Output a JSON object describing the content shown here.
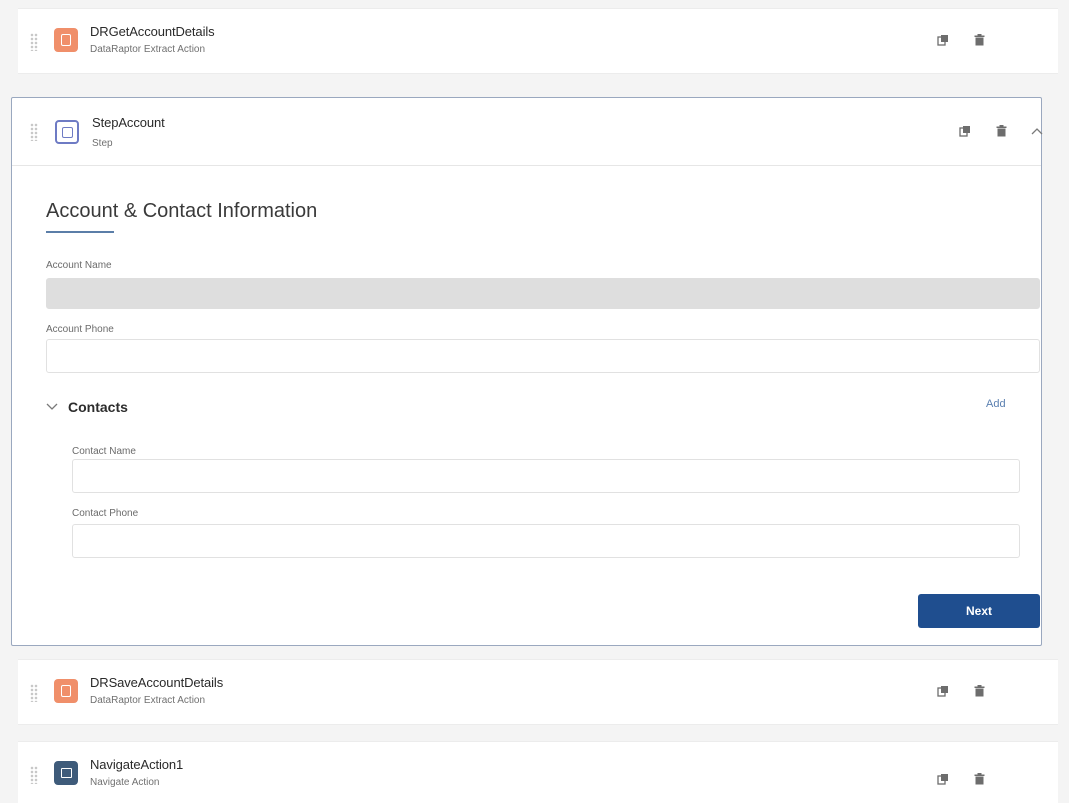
{
  "steps": [
    {
      "title": "DRGetAccountDetails",
      "subtitle": "DataRaptor Extract Action"
    },
    {
      "title": "StepAccount",
      "subtitle": "Step"
    },
    {
      "title": "DRSaveAccountDetails",
      "subtitle": "DataRaptor Extract Action"
    },
    {
      "title": "NavigateAction1",
      "subtitle": "Navigate Action"
    }
  ],
  "form": {
    "heading": "Account & Contact Information",
    "account_name_label": "Account Name",
    "account_name_value": "",
    "account_phone_label": "Account Phone",
    "account_phone_value": "",
    "contacts_label": "Contacts",
    "add_label": "Add",
    "contact_name_label": "Contact Name",
    "contact_name_value": "",
    "contact_phone_label": "Contact Phone",
    "contact_phone_value": "",
    "next_label": "Next"
  },
  "icons": {
    "drag": "drag-handle-icon",
    "copy": "copy-icon",
    "delete": "trash-icon",
    "collapse": "chevron-up-icon",
    "contacts_toggle": "chevron-down-icon"
  },
  "colors": {
    "action_icon": "#f08f6a",
    "step_icon": "#6e7bc4",
    "navigate_icon": "#3e5b7a",
    "primary_button": "#1f4e8f",
    "link": "#5a7fb0",
    "heading_underline": "#5b7ea8"
  }
}
